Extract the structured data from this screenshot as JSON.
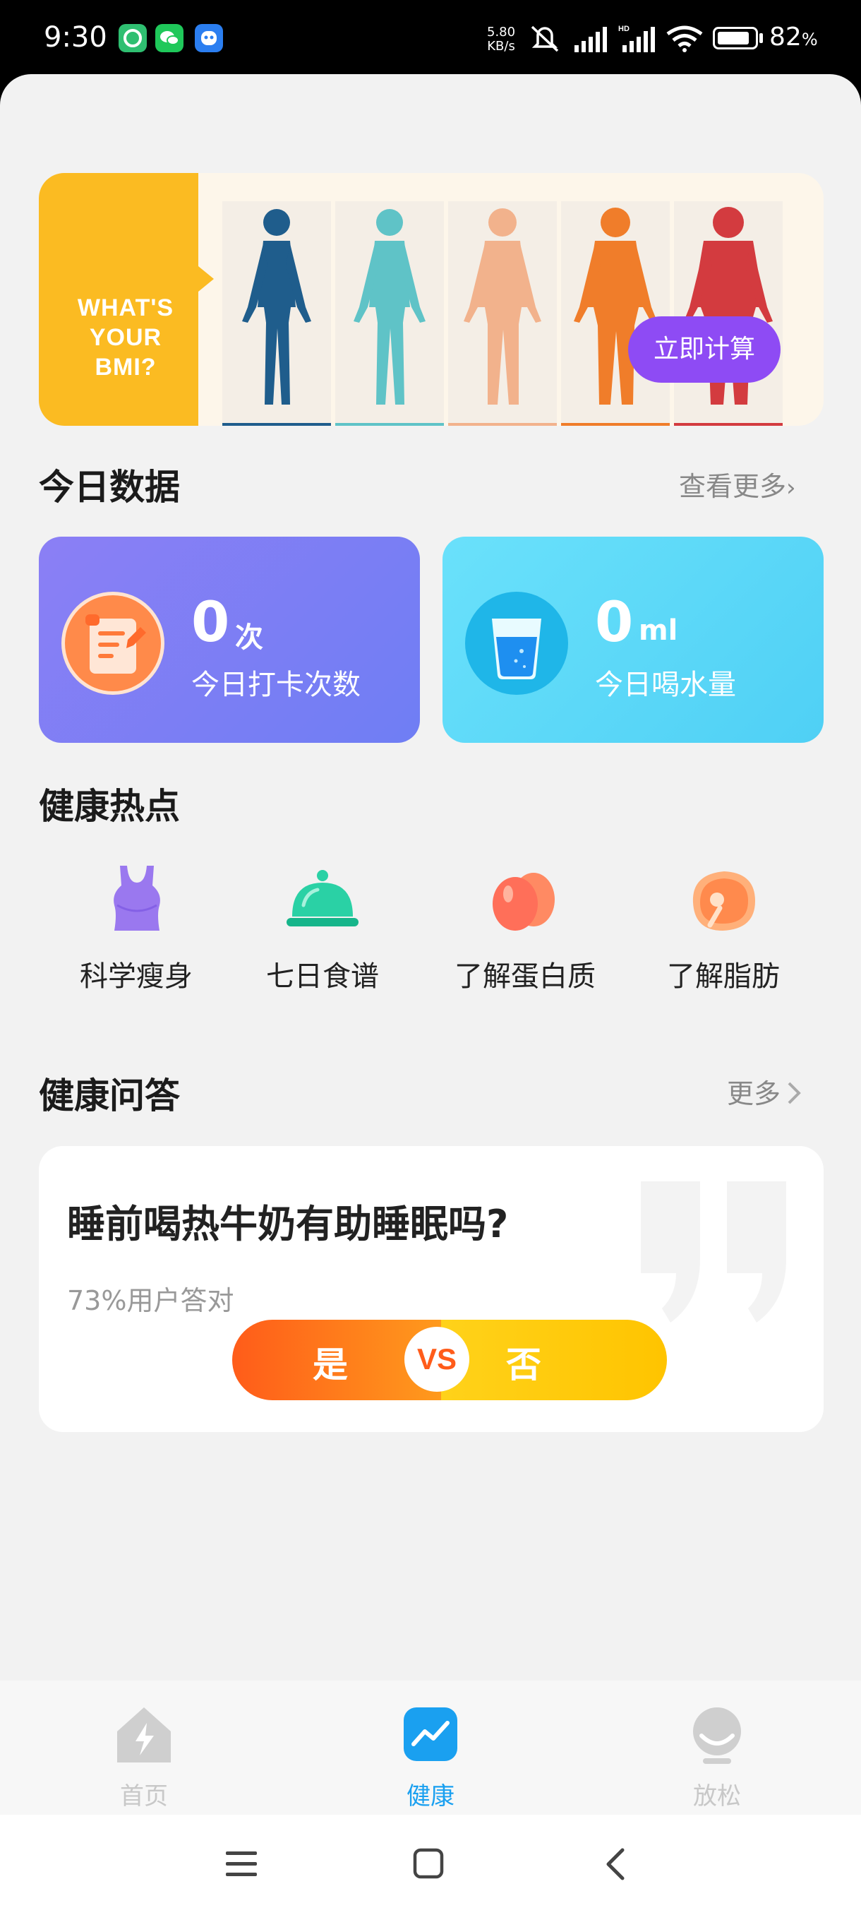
{
  "status_bar": {
    "time": "9:30",
    "speed_value": "5.80",
    "speed_unit": "KB/s",
    "battery_percent": "82",
    "battery_suffix": "%",
    "icons": [
      "app-icon-green",
      "wechat-icon",
      "app-icon-blue",
      "silent-icon",
      "signal-icon",
      "hd-signal-icon",
      "wifi-icon",
      "battery-icon"
    ]
  },
  "banner": {
    "text_lines": [
      "WHAT'S",
      "YOUR",
      "BMI?"
    ],
    "button_label": "立即计算",
    "figure_colors": [
      "#1f5d8c",
      "#5fc3c7",
      "#f2b28c",
      "#f07d2a",
      "#d33b3f"
    ]
  },
  "today_data": {
    "title": "今日数据",
    "more_label": "查看更多",
    "checkin": {
      "value": "0",
      "unit": "次",
      "label": "今日打卡次数",
      "icon": "notepad-icon"
    },
    "water": {
      "value": "0",
      "unit": "ml",
      "label": "今日喝水量",
      "icon": "water-glass-icon"
    }
  },
  "health_hot": {
    "title": "健康热点",
    "items": [
      {
        "label": "科学瘦身",
        "icon": "tank-top-icon"
      },
      {
        "label": "七日食谱",
        "icon": "food-cloche-icon"
      },
      {
        "label": "了解蛋白质",
        "icon": "eggs-icon"
      },
      {
        "label": "了解脂肪",
        "icon": "meat-icon"
      }
    ]
  },
  "health_qa": {
    "title": "健康问答",
    "more_label": "更多",
    "question": "睡前喝热牛奶有助睡眠吗?",
    "stat": "73%用户答对",
    "yes_label": "是",
    "vs_label": "VS",
    "no_label": "否"
  },
  "tabbar": {
    "tabs": [
      {
        "label": "首页",
        "icon": "home-icon",
        "active": false
      },
      {
        "label": "健康",
        "icon": "health-chart-icon",
        "active": true
      },
      {
        "label": "放松",
        "icon": "relax-face-icon",
        "active": false
      }
    ]
  },
  "colors": {
    "accent_purple": "#8e4bf4",
    "card_purple": "#7c80f5",
    "card_cyan": "#5ad6f7",
    "tab_active": "#1aa0f0",
    "tab_inactive": "#c8c8c8"
  }
}
